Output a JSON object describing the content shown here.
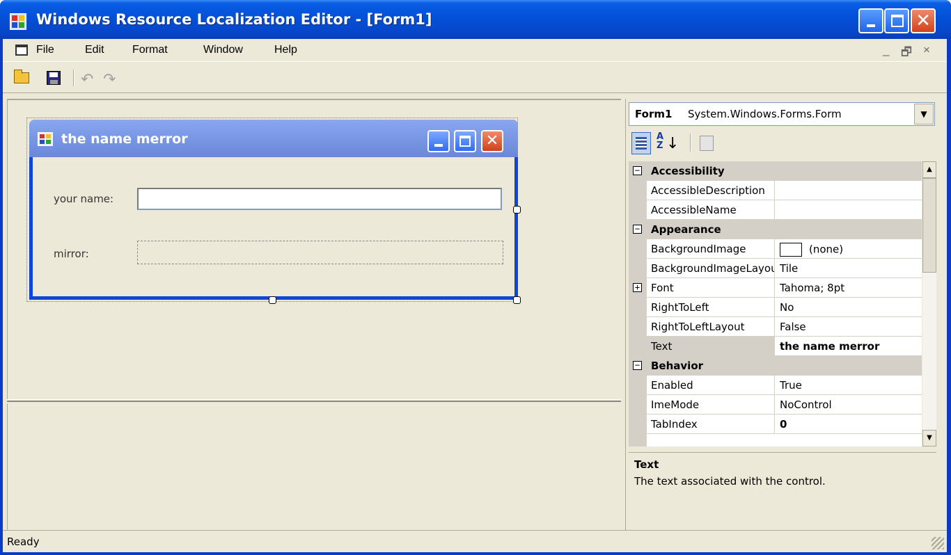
{
  "app": {
    "title": "Windows Resource Localization Editor - [Form1]"
  },
  "menu": {
    "items": [
      "File",
      "Edit",
      "Format",
      "Window",
      "Help"
    ],
    "mdi_minimize": "_",
    "mdi_restore": "🗗",
    "mdi_close": "×"
  },
  "toolbar": {
    "icons": [
      "open-folder-icon",
      "save-icon",
      "undo-icon",
      "redo-icon"
    ]
  },
  "designer": {
    "form_title": "the name merror",
    "name_label": "your name:",
    "name_value": "",
    "mirror_label": "mirror:"
  },
  "properties": {
    "object_name": "Form1",
    "object_type": "System.Windows.Forms.Form",
    "rows": [
      {
        "kind": "category",
        "name": "Accessibility"
      },
      {
        "kind": "prop",
        "name": "AccessibleDescription",
        "value": ""
      },
      {
        "kind": "prop",
        "name": "AccessibleName",
        "value": ""
      },
      {
        "kind": "category",
        "name": "Appearance"
      },
      {
        "kind": "prop",
        "name": "BackgroundImage",
        "value": "(none)"
      },
      {
        "kind": "prop",
        "name": "BackgroundImageLayout",
        "value": "Tile"
      },
      {
        "kind": "prop",
        "name": "Font",
        "value": "Tahoma; 8pt"
      },
      {
        "kind": "prop",
        "name": "RightToLeft",
        "value": "No"
      },
      {
        "kind": "prop",
        "name": "RightToLeftLayout",
        "value": "False"
      },
      {
        "kind": "prop",
        "name": "Text",
        "value": "the name merror"
      },
      {
        "kind": "category",
        "name": "Behavior"
      },
      {
        "kind": "prop",
        "name": "Enabled",
        "value": "True"
      },
      {
        "kind": "prop",
        "name": "ImeMode",
        "value": "NoControl"
      },
      {
        "kind": "prop",
        "name": "TabIndex",
        "value": "0"
      }
    ],
    "description_title": "Text",
    "description_text": "The text associated with the control."
  },
  "status": {
    "text": "Ready"
  },
  "colors": {
    "titlebar": "#0452d9",
    "face": "#ece9d8",
    "close_button": "#d0421a"
  }
}
